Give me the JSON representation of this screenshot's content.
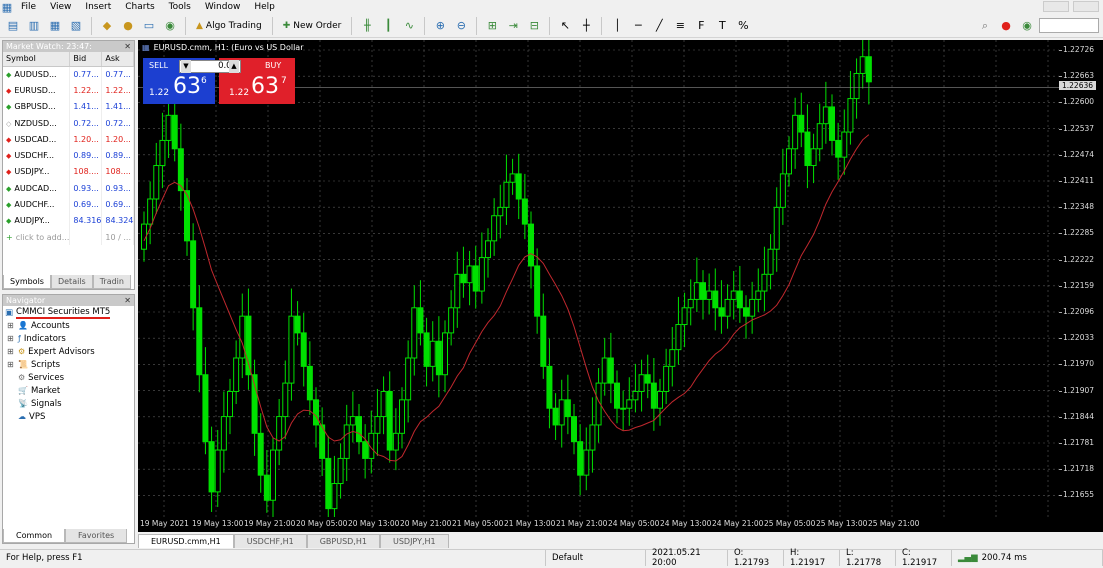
{
  "menu": [
    "File",
    "View",
    "Insert",
    "Charts",
    "Tools",
    "Window",
    "Help"
  ],
  "toolbar": {
    "algo_trading": "Algo Trading",
    "new_order": "New Order"
  },
  "market_watch": {
    "title": "Market Watch: 23:47:",
    "columns": [
      "Symbol",
      "Bid",
      "Ask"
    ],
    "rows": [
      {
        "symbol": "AUDUSD...",
        "bid": "0.77...",
        "ask": "0.77...",
        "color": "blue",
        "icon": "up"
      },
      {
        "symbol": "EURUSD...",
        "bid": "1.22...",
        "ask": "1.22...",
        "color": "red",
        "icon": "down"
      },
      {
        "symbol": "GBPUSD...",
        "bid": "1.41...",
        "ask": "1.41...",
        "color": "blue",
        "icon": "up"
      },
      {
        "symbol": "NZDUSD...",
        "bid": "0.72...",
        "ask": "0.72...",
        "color": "blue",
        "icon": "neutral"
      },
      {
        "symbol": "USDCAD...",
        "bid": "1.20...",
        "ask": "1.20...",
        "color": "red",
        "icon": "down"
      },
      {
        "symbol": "USDCHF...",
        "bid": "0.89...",
        "ask": "0.89...",
        "color": "blue",
        "icon": "down"
      },
      {
        "symbol": "USDJPY...",
        "bid": "108....",
        "ask": "108....",
        "color": "red",
        "icon": "down"
      },
      {
        "symbol": "AUDCAD...",
        "bid": "0.93...",
        "ask": "0.93...",
        "color": "blue",
        "icon": "up"
      },
      {
        "symbol": "AUDCHF...",
        "bid": "0.69...",
        "ask": "0.69...",
        "color": "blue",
        "icon": "up"
      },
      {
        "symbol": "AUDJPY...",
        "bid": "84.316",
        "ask": "84.324",
        "color": "blue",
        "icon": "up"
      }
    ],
    "add_row": "click to add...",
    "count": "10 / ...",
    "tabs": [
      "Symbols",
      "Details",
      "Tradin"
    ]
  },
  "navigator": {
    "title": "Navigator",
    "root": "CMMCI Securities MT5",
    "items": [
      "Accounts",
      "Indicators",
      "Expert Advisors",
      "Scripts",
      "Services",
      "Market",
      "Signals",
      "VPS"
    ],
    "tabs": [
      "Common",
      "Favorites"
    ]
  },
  "chart": {
    "title": "EURUSD.cmm, H1:  (Euro vs US Dollar",
    "sell_label": "SELL",
    "buy_label": "BUY",
    "lot": "0.01",
    "sell_prefix": "1.22",
    "sell_big": "63",
    "sell_sup": "6",
    "buy_prefix": "1.22",
    "buy_big": "63",
    "buy_sup": "7",
    "current_price": "1.22636",
    "price_ticks": [
      "1.22726",
      "1.22663",
      "1.22600",
      "1.22537",
      "1.22474",
      "1.22411",
      "1.22348",
      "1.22285",
      "1.22222",
      "1.22159",
      "1.22096",
      "1.22033",
      "1.21970",
      "1.21907",
      "1.21844",
      "1.21781",
      "1.21718",
      "1.21655"
    ],
    "time_ticks": [
      "19 May 2021",
      "19 May 13:00",
      "19 May 21:00",
      "20 May 05:00",
      "20 May 13:00",
      "20 May 21:00",
      "21 May 05:00",
      "21 May 13:00",
      "21 May 21:00",
      "24 May 05:00",
      "24 May 13:00",
      "24 May 21:00",
      "25 May 05:00",
      "25 May 13:00",
      "25 May 21:00"
    ],
    "tabs": [
      "EURUSD.cmm,H1",
      "USDCHF,H1",
      "GBPUSD,H1",
      "USDJPY,H1"
    ],
    "colors": {
      "bull": "#00e000",
      "bear": "#00e000",
      "bull_body": "#000000",
      "ma": "#c0282e",
      "grid": "#5a5a5a",
      "bg": "#000000"
    }
  },
  "chart_data": {
    "type": "candlestick",
    "ylim": [
      1.2162,
      1.2276
    ],
    "closes": [
      1.2232,
      1.2238,
      1.2246,
      1.2252,
      1.2258,
      1.225,
      1.224,
      1.2228,
      1.2212,
      1.2196,
      1.218,
      1.2168,
      1.2178,
      1.2186,
      1.2192,
      1.22,
      1.221,
      1.2196,
      1.2182,
      1.2172,
      1.2166,
      1.2178,
      1.2186,
      1.2194,
      1.221,
      1.2206,
      1.2198,
      1.219,
      1.2184,
      1.2176,
      1.2164,
      1.217,
      1.2176,
      1.2184,
      1.2186,
      1.218,
      1.2176,
      1.2182,
      1.2186,
      1.2192,
      1.2178,
      1.2182,
      1.219,
      1.22,
      1.2212,
      1.2206,
      1.2198,
      1.2204,
      1.2196,
      1.2206,
      1.2212,
      1.222,
      1.2218,
      1.2222,
      1.2216,
      1.2224,
      1.2228,
      1.2234,
      1.2236,
      1.2242,
      1.2244,
      1.2238,
      1.2232,
      1.2222,
      1.221,
      1.2198,
      1.2188,
      1.2184,
      1.219,
      1.2186,
      1.218,
      1.2172,
      1.2178,
      1.2184,
      1.2194,
      1.22,
      1.2194,
      1.2188,
      1.2188,
      1.219,
      1.2192,
      1.2196,
      1.2194,
      1.2188,
      1.2192,
      1.2198,
      1.2202,
      1.2208,
      1.2212,
      1.2214,
      1.2218,
      1.2214,
      1.2216,
      1.2212,
      1.221,
      1.2214,
      1.2216,
      1.2212,
      1.221,
      1.2214,
      1.2216,
      1.222,
      1.2226,
      1.2236,
      1.2244,
      1.225,
      1.2258,
      1.2254,
      1.2246,
      1.225,
      1.2256,
      1.226,
      1.2252,
      1.2248,
      1.2254,
      1.2262,
      1.2268,
      1.2272,
      1.2266
    ]
  },
  "status": {
    "help": "For Help, press F1",
    "profile": "Default",
    "time": "2021.05.21 20:00",
    "open": "O: 1.21793",
    "high": "H: 1.21917",
    "low": "L: 1.21778",
    "close": "C: 1.21917",
    "ping": "200.74 ms"
  }
}
